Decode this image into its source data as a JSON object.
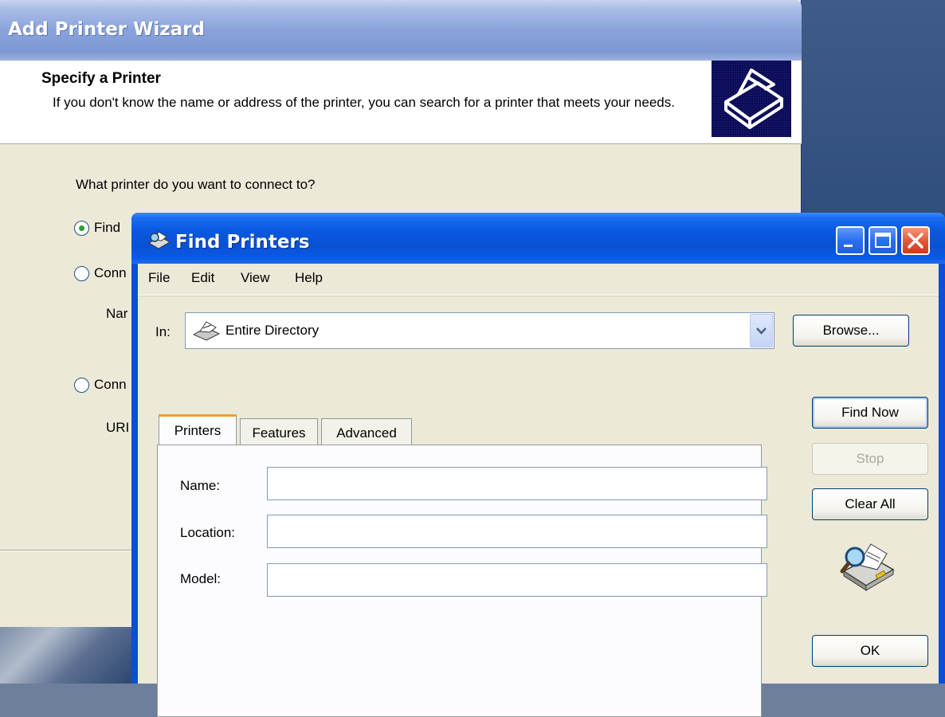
{
  "wizard": {
    "title": "Add Printer Wizard",
    "heading": "Specify a Printer",
    "subtitle": "If you don't know the name or address of the printer, you can search for a printer that meets your needs.",
    "question": "What printer do you want to connect to?",
    "options": [
      {
        "label": "Find",
        "checked": true
      },
      {
        "label": "Conn",
        "checked": false
      },
      {
        "label": "Conn",
        "checked": false
      }
    ],
    "name_label": "Nar",
    "url_label": "URI"
  },
  "find": {
    "title": "Find Printers",
    "menu": [
      "File",
      "Edit",
      "View",
      "Help"
    ],
    "in_label": "In:",
    "in_value": "Entire Directory",
    "browse": "Browse...",
    "tabs": [
      "Printers",
      "Features",
      "Advanced"
    ],
    "fields": [
      {
        "label": "Name:",
        "value": ""
      },
      {
        "label": "Location:",
        "value": ""
      },
      {
        "label": "Model:",
        "value": ""
      }
    ],
    "buttons": {
      "find_now": "Find Now",
      "stop": "Stop",
      "clear_all": "Clear All",
      "ok": "OK"
    }
  },
  "colors": {
    "xp_blue": "#0a58e0",
    "window_bg": "#ece9d8",
    "wizard_title": "#8aa3db",
    "tab_accent": "#f2a02a"
  }
}
